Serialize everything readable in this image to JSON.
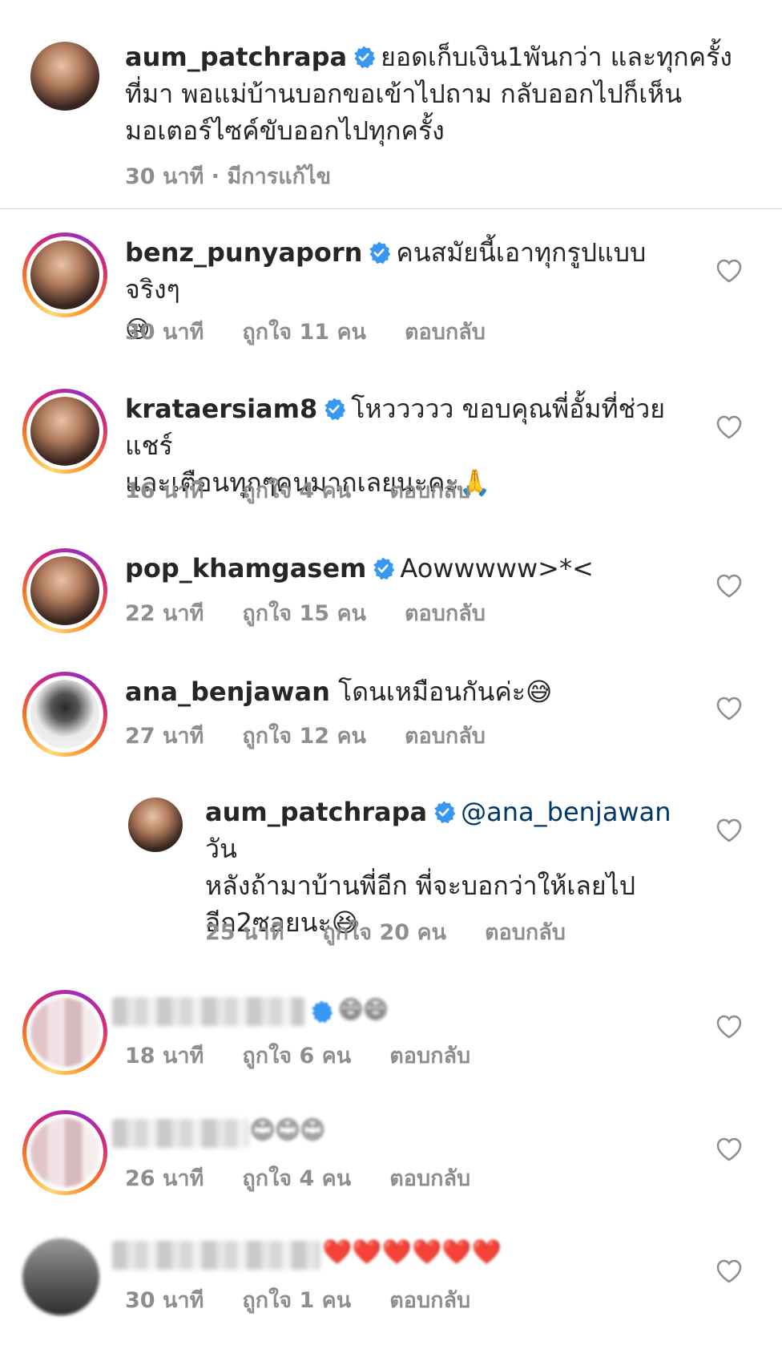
{
  "colors": {
    "verified": "#3897f0",
    "meta_text": "#8e8e8e",
    "mention": "#00376b"
  },
  "top_comment": {
    "username": "aum_patchrapa",
    "line1": "ยอดเก็บเงิน1พันกว่า  และทุกครั้ง",
    "line2": "ที่มา  พอแม่บ้านบอกขอเข้าไปถาม  กลับออกไปก็เห็น",
    "line3": "มอเตอร์ไซค์ขับออกไปทุกครั้ง",
    "meta": "30 นาที · มีการแก้ไข"
  },
  "comments": [
    {
      "username": "benz_punyaporn",
      "line1": "คนสมัยนี้เอาทุกรูปแบบจริงๆ",
      "emoji": "😢",
      "time": "30 นาที",
      "likes": "ถูกใจ 11 คน",
      "reply": "ตอบกลับ"
    },
    {
      "username": "krataersiam8",
      "line1": "โหววววว ขอบคุณพี่อั้มที่ช่วยแชร์",
      "line2": "และเตือนทุกๆคนมากเลยนะคะ🙏",
      "time": "16 นาที",
      "likes": "ถูกใจ 4 คน",
      "reply": "ตอบกลับ"
    },
    {
      "username": "pop_khamgasem",
      "line1": "Aowwwww>*<",
      "time": "22 นาที",
      "likes": "ถูกใจ 15 คน",
      "reply": "ตอบกลับ"
    },
    {
      "username": "ana_benjawan",
      "line1": "โดนเหมือนกันค่ะ😅",
      "time": "27 นาที",
      "likes": "ถูกใจ 12 คน",
      "reply": "ตอบกลับ"
    }
  ],
  "reply": {
    "username": "aum_patchrapa",
    "mention": "@ana_benjawan",
    "line1_tail": "วัน",
    "line2": "หลังถ้ามาบ้านพี่อีก  พี่จะบอกว่าให้เลยไป",
    "line3": "อีก2ซอยนะ😆",
    "time": "25 นาที",
    "likes": "ถูกใจ 20 คน",
    "reply_label": "ตอบกลับ"
  },
  "blurred_comments": [
    {
      "emoji": "😄😄",
      "time": "18 นาที",
      "likes": "ถูกใจ 6 คน",
      "reply": "ตอบกลับ"
    },
    {
      "emoji": "😊😊😊",
      "time": "26 นาที",
      "likes": "ถูกใจ 4 คน",
      "reply": "ตอบกลับ"
    },
    {
      "emoji": "❤️❤️❤️❤️❤️❤️",
      "time": "30 นาที",
      "likes": "ถูกใจ 1 คน",
      "reply": "ตอบกลับ"
    }
  ]
}
